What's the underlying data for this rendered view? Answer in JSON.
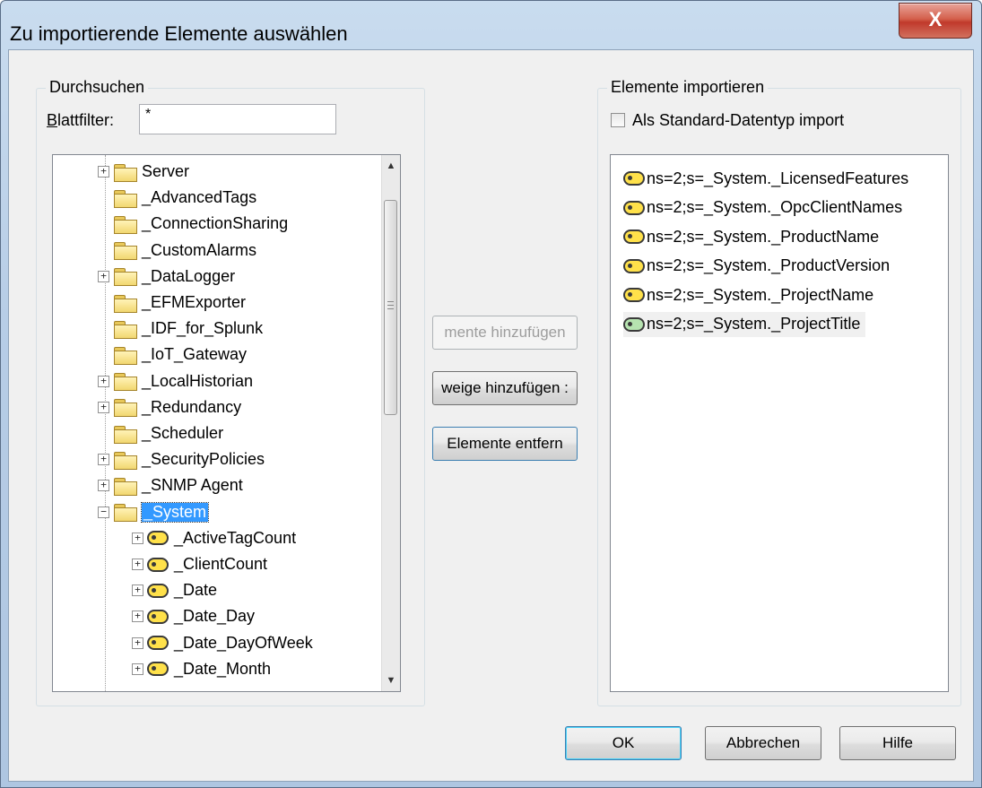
{
  "window": {
    "title": "Zu importierende Elemente auswählen",
    "close_glyph": "X"
  },
  "browse": {
    "legend": "Durchsuchen",
    "filter_label_hot": "B",
    "filter_label_rest": "lattfilter:",
    "filter_value": "*",
    "tree": [
      {
        "label": "Server",
        "expander": "+",
        "icon": "folder-icon",
        "level": 0
      },
      {
        "label": "_AdvancedTags",
        "expander": "",
        "icon": "folder-icon",
        "level": 0
      },
      {
        "label": "_ConnectionSharing",
        "expander": "",
        "icon": "folder-icon",
        "level": 0
      },
      {
        "label": "_CustomAlarms",
        "expander": "",
        "icon": "folder-icon",
        "level": 0
      },
      {
        "label": "_DataLogger",
        "expander": "+",
        "icon": "folder-icon",
        "level": 0
      },
      {
        "label": "_EFMExporter",
        "expander": "",
        "icon": "folder-icon",
        "level": 0
      },
      {
        "label": "_IDF_for_Splunk",
        "expander": "",
        "icon": "folder-icon",
        "level": 0
      },
      {
        "label": "_IoT_Gateway",
        "expander": "",
        "icon": "folder-icon",
        "level": 0
      },
      {
        "label": "_LocalHistorian",
        "expander": "+",
        "icon": "folder-icon",
        "level": 0
      },
      {
        "label": "_Redundancy",
        "expander": "+",
        "icon": "folder-icon",
        "level": 0
      },
      {
        "label": "_Scheduler",
        "expander": "",
        "icon": "folder-icon",
        "level": 0
      },
      {
        "label": "_SecurityPolicies",
        "expander": "+",
        "icon": "folder-icon",
        "level": 0
      },
      {
        "label": "_SNMP Agent",
        "expander": "+",
        "icon": "folder-icon",
        "level": 0
      },
      {
        "label": "_System",
        "expander": "−",
        "icon": "folder-open-icon",
        "level": 0,
        "selected": true
      },
      {
        "label": "_ActiveTagCount",
        "expander": "+",
        "icon": "tag-icon",
        "level": 1
      },
      {
        "label": "_ClientCount",
        "expander": "+",
        "icon": "tag-icon",
        "level": 1
      },
      {
        "label": "_Date",
        "expander": "+",
        "icon": "tag-icon",
        "level": 1
      },
      {
        "label": "_Date_Day",
        "expander": "+",
        "icon": "tag-icon",
        "level": 1
      },
      {
        "label": "_Date_DayOfWeek",
        "expander": "+",
        "icon": "tag-icon",
        "level": 1
      },
      {
        "label": "_Date_Month",
        "expander": "+",
        "icon": "tag-icon",
        "level": 1
      }
    ],
    "scroll_up_glyph": "▲",
    "scroll_down_glyph": "▼"
  },
  "middle": {
    "add_items_label": "mente hinzufügen",
    "add_branch_label": "weige hinzufügen :",
    "remove_items_label": "Elemente entfern"
  },
  "import": {
    "legend": "Elemente importieren",
    "default_type_label": "Als Standard-Datentyp import",
    "default_type_checked": false,
    "items": [
      {
        "label": "ns=2;s=_System._LicensedFeatures",
        "icon": "tag-icon"
      },
      {
        "label": "ns=2;s=_System._OpcClientNames",
        "icon": "tag-icon"
      },
      {
        "label": "ns=2;s=_System._ProductName",
        "icon": "tag-icon"
      },
      {
        "label": "ns=2;s=_System._ProductVersion",
        "icon": "tag-icon"
      },
      {
        "label": "ns=2;s=_System._ProjectName",
        "icon": "tag-icon"
      },
      {
        "label": "ns=2;s=_System._ProjectTitle",
        "icon": "tag-active-icon",
        "selected": true
      }
    ]
  },
  "footer": {
    "ok_label": "OK",
    "cancel_label": "Abbrechen",
    "help_label": "Hilfe"
  }
}
